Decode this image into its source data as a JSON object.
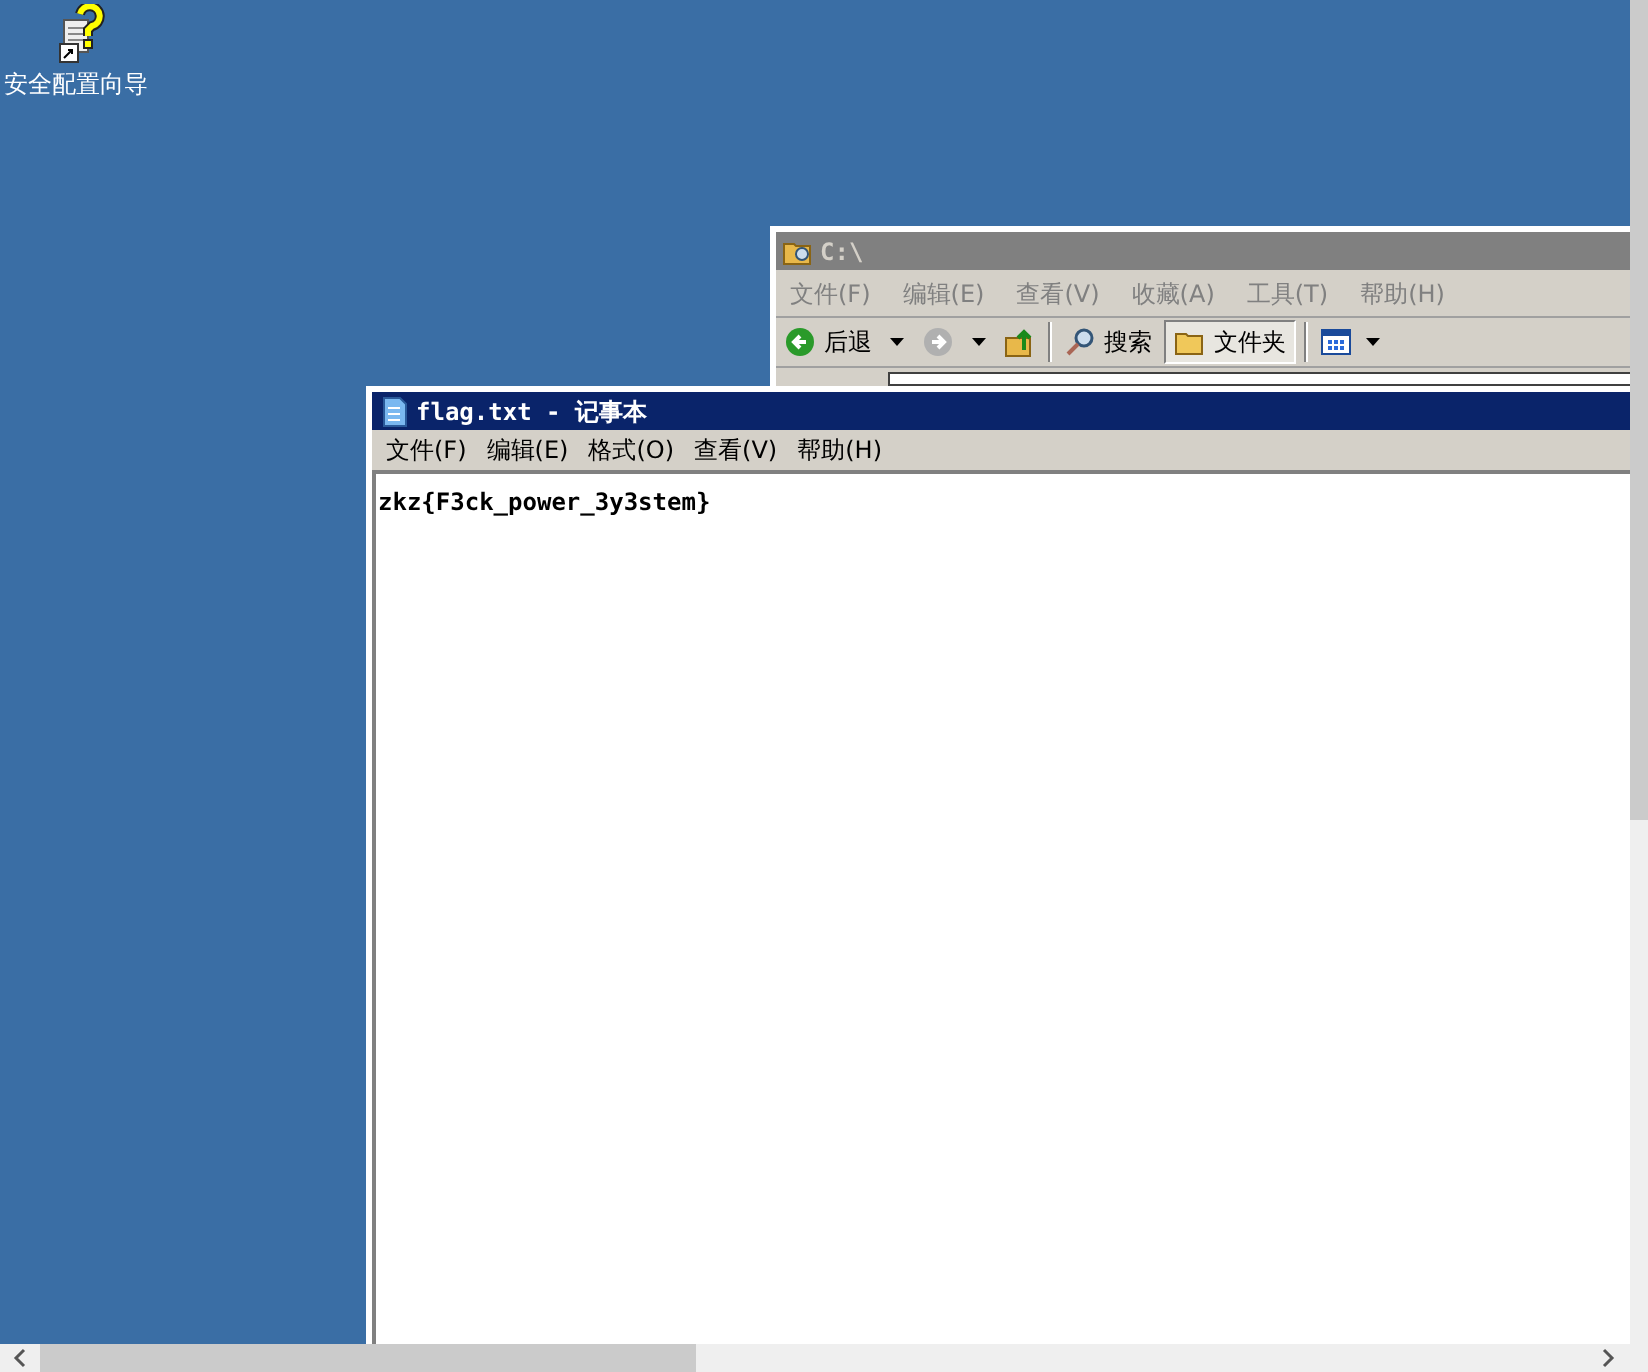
{
  "desktop": {
    "icons": [
      {
        "label": "安全配置向导"
      }
    ]
  },
  "explorer": {
    "title": "C:\\",
    "active": false,
    "menu": [
      "文件(F)",
      "编辑(E)",
      "查看(V)",
      "收藏(A)",
      "工具(T)",
      "帮助(H)"
    ],
    "toolbar": [
      {
        "kind": "back",
        "label": "后退"
      },
      {
        "kind": "forward"
      },
      {
        "kind": "up"
      },
      {
        "kind": "search",
        "label": "搜索"
      },
      {
        "kind": "folders",
        "label": "文件夹",
        "selected": true
      },
      {
        "kind": "views"
      }
    ]
  },
  "notepad": {
    "title": "flag.txt - 记事本",
    "active": true,
    "menu": [
      "文件(F)",
      "编辑(E)",
      "格式(O)",
      "查看(V)",
      "帮助(H)"
    ],
    "content": "zkz{F3ck_power_3y3stem}"
  }
}
